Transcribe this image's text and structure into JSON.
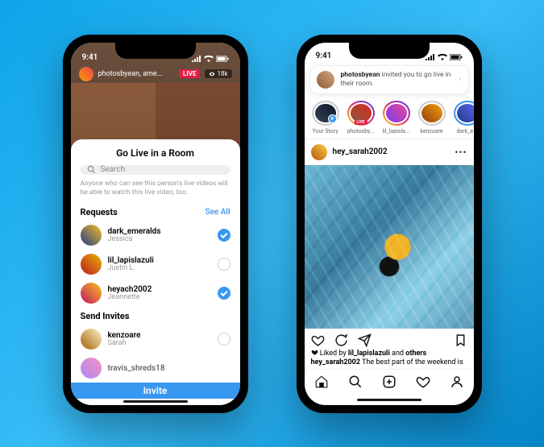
{
  "status": {
    "time": "9:41"
  },
  "phone1": {
    "live_header": {
      "username": "photosbyean, ame...",
      "live_label": "LIVE",
      "viewers": "18k"
    },
    "sheet": {
      "title": "Go Live in a Room",
      "search_placeholder": "Search",
      "helper": "Anyone who can see this person's live videos will be able to watch this live video, too.",
      "requests_label": "Requests",
      "see_all": "See All",
      "send_invites_label": "Send Invites",
      "invite_button": "Invite",
      "requests": [
        {
          "username": "dark_emeralds",
          "name": "Jessica",
          "selected": true
        },
        {
          "username": "lil_lapislazuli",
          "name": "Justin L.",
          "selected": false
        },
        {
          "username": "heyach2002",
          "name": "Jeannette",
          "selected": true
        }
      ],
      "invites": [
        {
          "username": "kenzoare",
          "name": "Sarah"
        },
        {
          "username": "travis_shreds18",
          "name": ""
        }
      ]
    }
  },
  "phone2": {
    "banner": {
      "actor": "photosbyean",
      "text": " invited you to go live in their room."
    },
    "stories": [
      {
        "label": "Your Story",
        "ring": "none",
        "own": true,
        "live": false
      },
      {
        "label": "photosby...",
        "ring": "grad",
        "own": false,
        "live": true,
        "live_label": "LIVE"
      },
      {
        "label": "lil_lapisla...",
        "ring": "grad",
        "own": false,
        "live": false
      },
      {
        "label": "kenzoare",
        "ring": "none",
        "own": false,
        "live": false
      },
      {
        "label": "dark_e...",
        "ring": "blue",
        "own": false,
        "live": false
      }
    ],
    "post": {
      "username": "hey_sarah2002",
      "liked_by_prefix": "Liked by ",
      "liked_by_user": "lil_lapislazuli",
      "liked_by_suffix": " and ",
      "liked_by_others": "others",
      "caption_user": "hey_sarah2002",
      "caption_text": " The best part of the weekend is"
    }
  }
}
